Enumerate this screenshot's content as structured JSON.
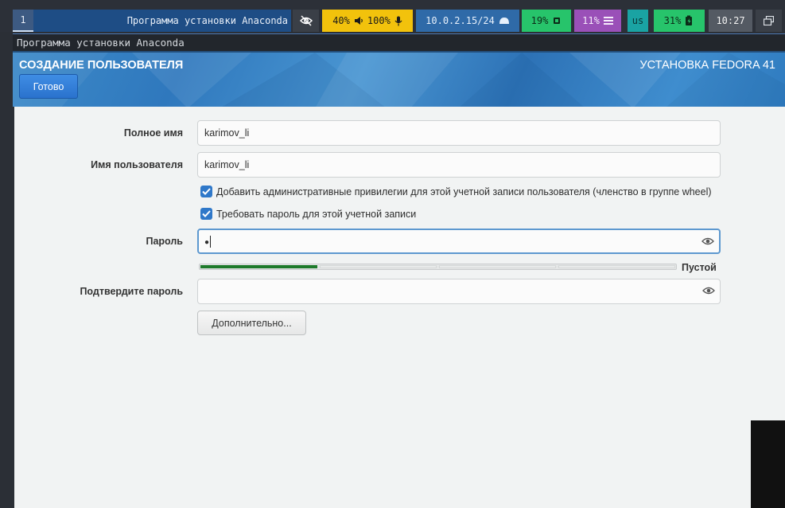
{
  "statusbar": {
    "workspace": "1",
    "window_title": "Программа установки Anaconda",
    "audio": {
      "brightness": "40%",
      "volume": "100%"
    },
    "network": {
      "ip": "10.0.2.15/24"
    },
    "cpu": "19%",
    "memory": "11%",
    "keyboard": "us",
    "battery": "31%",
    "clock": "10:27",
    "icons": [
      "eye-slash-icon",
      "speaker-icon",
      "microphone-icon",
      "cloud-icon",
      "chip-icon",
      "memory-icon",
      "battery-charging-icon",
      "windows-icon"
    ]
  },
  "window": {
    "title": "Программа установки Anaconda"
  },
  "header": {
    "spoke_title": "СОЗДАНИЕ ПОЛЬЗОВАТЕЛЯ",
    "product_title": "УСТАНОВКА FEDORA 41",
    "done_label": "Готово"
  },
  "form": {
    "fullname_label": "Полное имя",
    "fullname_value": "karimov_li",
    "username_label": "Имя пользователя",
    "username_value": "karimov_li",
    "admin_checkbox_label": "Добавить административные привилегии для этой учетной записи пользователя (членство в группе wheel)",
    "admin_checked": true,
    "require_password_label": "Требовать пароль для этой учетной записи",
    "require_password_checked": true,
    "password_label": "Пароль",
    "password_value": "●",
    "strength_level": 0.25,
    "strength_text": "Пустой",
    "confirm_label": "Подтвердите пароль",
    "confirm_value": "",
    "advanced_label": "Дополнительно..."
  },
  "colors": {
    "accent": "#2f78c9",
    "strength_fill": "#1e7a2b",
    "header_blue": "#3d8ac9"
  }
}
